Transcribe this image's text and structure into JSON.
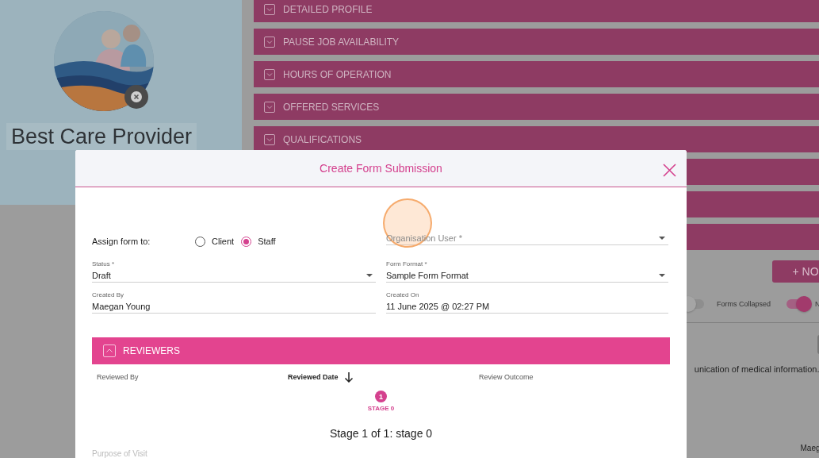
{
  "profile": {
    "name": "Best Care Provider"
  },
  "sections": [
    {
      "label": "DETAILED PROFILE",
      "expanded": false
    },
    {
      "label": "PAUSE JOB AVAILABILITY",
      "expanded": false
    },
    {
      "label": "HOURS OF OPERATION",
      "expanded": false
    },
    {
      "label": "OFFERED SERVICES",
      "expanded": false
    },
    {
      "label": "QUALIFICATIONS",
      "expanded": false
    }
  ],
  "new_button": {
    "label": "+ NO"
  },
  "toggles": [
    {
      "label": "Forms Collapsed",
      "on": false
    },
    {
      "label": "N",
      "on": true
    }
  ],
  "background_text": "unication of medical information.",
  "background_name": "Maeg",
  "modal": {
    "title": "Create Form Submission",
    "assign_label": "Assign form to:",
    "assign_options": [
      {
        "label": "Client",
        "selected": false
      },
      {
        "label": "Staff",
        "selected": true
      }
    ],
    "organisation_user": {
      "placeholder": "Organisation User *"
    },
    "fields": [
      {
        "kind": "select",
        "label": "Status *",
        "value": "Draft"
      },
      {
        "kind": "select",
        "label": "Form Format *",
        "value": "Sample Form Format"
      },
      {
        "kind": "text",
        "label": "Created By",
        "value": "Maegan Young"
      },
      {
        "kind": "text",
        "label": "Created On",
        "value": "11 June 2025 @ 02:27 PM"
      }
    ],
    "reviewers": {
      "title": "REVIEWERS",
      "expanded": true,
      "columns": [
        {
          "label": "Reviewed By",
          "sorted": false
        },
        {
          "label": "Reviewed Date",
          "sorted": true
        },
        {
          "label": "Review Outcome",
          "sorted": false
        }
      ],
      "stages": [
        {
          "number": "1",
          "label": "STAGE 0",
          "selected": true
        }
      ],
      "summary": "Stage 1 of 1: stage 0"
    },
    "next_field_label": "Purpose of Visit"
  }
}
